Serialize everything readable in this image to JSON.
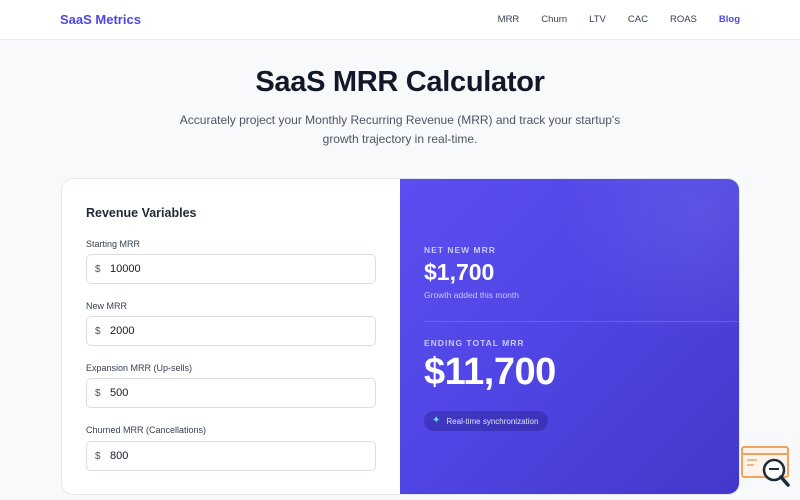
{
  "header": {
    "brand": "SaaS Metrics",
    "nav": [
      {
        "label": "MRR"
      },
      {
        "label": "Churn"
      },
      {
        "label": "LTV"
      },
      {
        "label": "CAC"
      },
      {
        "label": "ROAS"
      },
      {
        "label": "Blog",
        "active": true
      }
    ]
  },
  "hero": {
    "title": "SaaS MRR Calculator",
    "subtitle": "Accurately project your Monthly Recurring Revenue (MRR) and track your startup's growth trajectory in real-time."
  },
  "form": {
    "title": "Revenue Variables",
    "currency_symbol": "$",
    "fields": [
      {
        "label": "Starting MRR",
        "value": "10000"
      },
      {
        "label": "New MRR",
        "value": "2000"
      },
      {
        "label": "Expansion MRR (Up-sells)",
        "value": "500"
      },
      {
        "label": "Churned MRR (Cancellations)",
        "value": "800"
      }
    ]
  },
  "results": {
    "net_label": "NET NEW MRR",
    "net_value": "$1,700",
    "net_caption": "Growth added this month",
    "total_label": "ENDING TOTAL MRR",
    "total_value": "$11,700",
    "sync_badge": "Real-time synchronization"
  },
  "icons": {
    "sync_icon": "sparkle-icon",
    "corner_widget": "search-widget-icon"
  },
  "colors": {
    "accent": "#4f46e5",
    "panel_gradient_start": "#5b4ef0",
    "panel_gradient_end": "#4338ca",
    "sparkle": "#5eead4",
    "widget_orange": "#f0a35e"
  }
}
